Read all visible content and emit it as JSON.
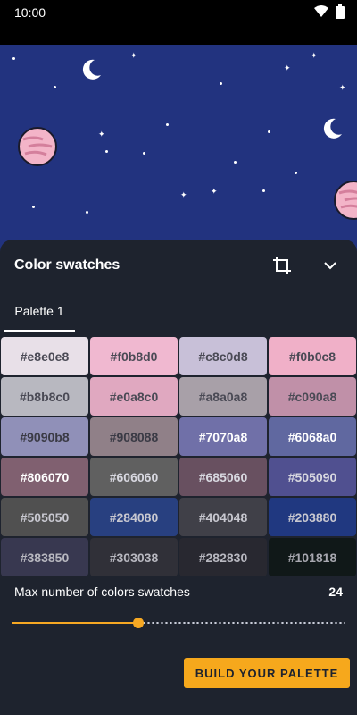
{
  "status_bar": {
    "time": "10:00"
  },
  "header": {
    "title": "Color swatches"
  },
  "tabs": [
    {
      "label": "Palette 1"
    }
  ],
  "swatches": [
    {
      "label": "#e8e0e8",
      "bg": "#e8e0e8",
      "fg": "#4a4a55"
    },
    {
      "label": "#f0b8d0",
      "bg": "#f0b8d0",
      "fg": "#4a4a55"
    },
    {
      "label": "#c8c0d8",
      "bg": "#c8c0d8",
      "fg": "#4a4a55"
    },
    {
      "label": "#f0b0c8",
      "bg": "#f0b0c8",
      "fg": "#4a4a55"
    },
    {
      "label": "#b8b8c0",
      "bg": "#b8b8c0",
      "fg": "#4a4a55"
    },
    {
      "label": "#e0a8c0",
      "bg": "#e0a8c0",
      "fg": "#4a4a55"
    },
    {
      "label": "#a8a0a8",
      "bg": "#a8a0a8",
      "fg": "#4a4a55"
    },
    {
      "label": "#c090a8",
      "bg": "#c090a8",
      "fg": "#4a4a55"
    },
    {
      "label": "#9090b8",
      "bg": "#9090b8",
      "fg": "#3a3a45"
    },
    {
      "label": "#908088",
      "bg": "#908088",
      "fg": "#3a3a45"
    },
    {
      "label": "#7070a8",
      "bg": "#7070a8",
      "fg": "#ffffff"
    },
    {
      "label": "#6068a0",
      "bg": "#6068a0",
      "fg": "#ffffff"
    },
    {
      "label": "#806070",
      "bg": "#806070",
      "fg": "#ffffff"
    },
    {
      "label": "#606060",
      "bg": "#606060",
      "fg": "#d8d8e0"
    },
    {
      "label": "#685060",
      "bg": "#685060",
      "fg": "#d8d8e0"
    },
    {
      "label": "#505090",
      "bg": "#505090",
      "fg": "#d8d8e0"
    },
    {
      "label": "#505050",
      "bg": "#505050",
      "fg": "#c8c8d0"
    },
    {
      "label": "#284080",
      "bg": "#284080",
      "fg": "#c8c8d0"
    },
    {
      "label": "#404048",
      "bg": "#404048",
      "fg": "#c8c8d0"
    },
    {
      "label": "#203880",
      "bg": "#203880",
      "fg": "#c8c8d0"
    },
    {
      "label": "#383850",
      "bg": "#383850",
      "fg": "#b8b8c0"
    },
    {
      "label": "#303038",
      "bg": "#303038",
      "fg": "#b8b8c0"
    },
    {
      "label": "#282830",
      "bg": "#282830",
      "fg": "#b8b8c0"
    },
    {
      "label": "#101818",
      "bg": "#101818",
      "fg": "#a8a8b0"
    }
  ],
  "max_colors": {
    "label": "Max number of colors swatches",
    "value": "24"
  },
  "slider": {
    "fraction": 0.38
  },
  "build_button": {
    "label": "BUILD YOUR PALETTE"
  },
  "colors": {
    "accent": "#f6a823",
    "sky": "#22337f",
    "sheet": "#1e232e"
  },
  "icons": [
    "wifi-icon",
    "battery-icon",
    "crop-icon",
    "chevron-down-icon"
  ]
}
